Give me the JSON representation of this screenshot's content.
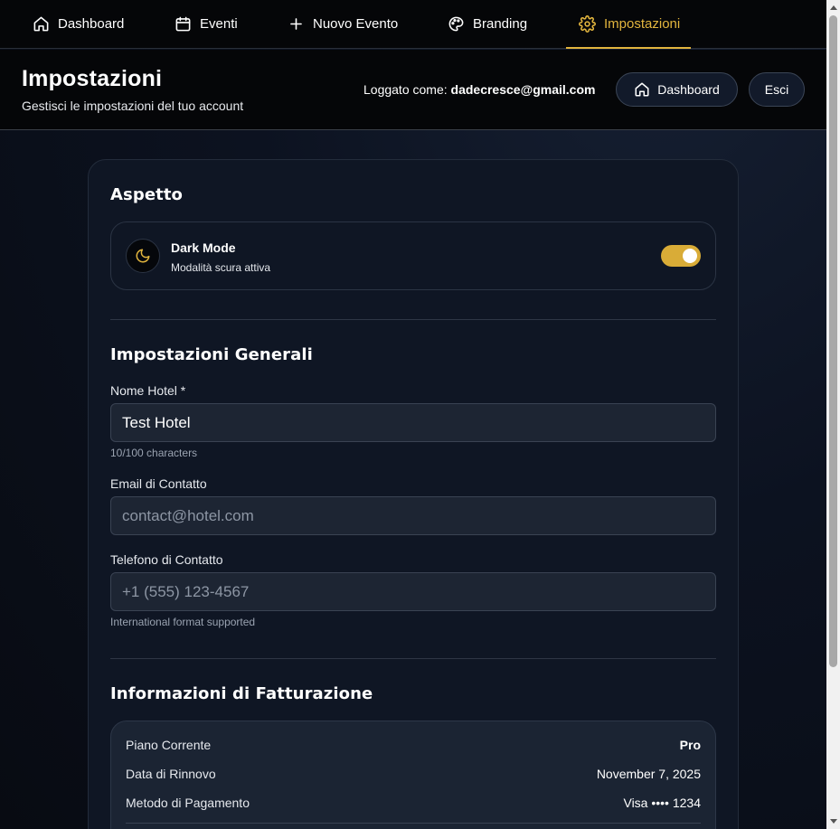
{
  "nav": {
    "items": [
      {
        "label": "Dashboard",
        "icon": "home-icon"
      },
      {
        "label": "Eventi",
        "icon": "calendar-icon"
      },
      {
        "label": "Nuovo Evento",
        "icon": "plus-icon"
      },
      {
        "label": "Branding",
        "icon": "palette-icon"
      },
      {
        "label": "Impostazioni",
        "icon": "gear-icon",
        "active": true
      }
    ]
  },
  "header": {
    "title": "Impostazioni",
    "subtitle": "Gestisci le impostazioni del tuo account",
    "logged_prefix": "Loggato come:",
    "logged_email": "dadecresce@gmail.com",
    "dashboard_button": "Dashboard",
    "logout_button": "Esci"
  },
  "appearance": {
    "title": "Aspetto",
    "dark_mode_label": "Dark Mode",
    "dark_mode_status": "Modalità scura attiva",
    "dark_mode_enabled": true
  },
  "general": {
    "title": "Impostazioni Generali",
    "hotel_name_label": "Nome Hotel *",
    "hotel_name_value": "Test Hotel",
    "hotel_name_hint": "10/100 characters",
    "email_label": "Email di Contatto",
    "email_placeholder": "contact@hotel.com",
    "phone_label": "Telefono di Contatto",
    "phone_placeholder": "+1 (555) 123-4567",
    "phone_hint": "International format supported"
  },
  "billing": {
    "title": "Informazioni di Fatturazione",
    "rows": [
      {
        "label": "Piano Corrente",
        "value": "Pro"
      },
      {
        "label": "Data di Rinnovo",
        "value": "November 7, 2025"
      },
      {
        "label": "Metodo di Pagamento",
        "value": "Visa •••• 1234"
      }
    ]
  },
  "colors": {
    "accent": "#e2b53e",
    "background": "#050608",
    "card": "#0f1624",
    "input": "#1d2533"
  }
}
